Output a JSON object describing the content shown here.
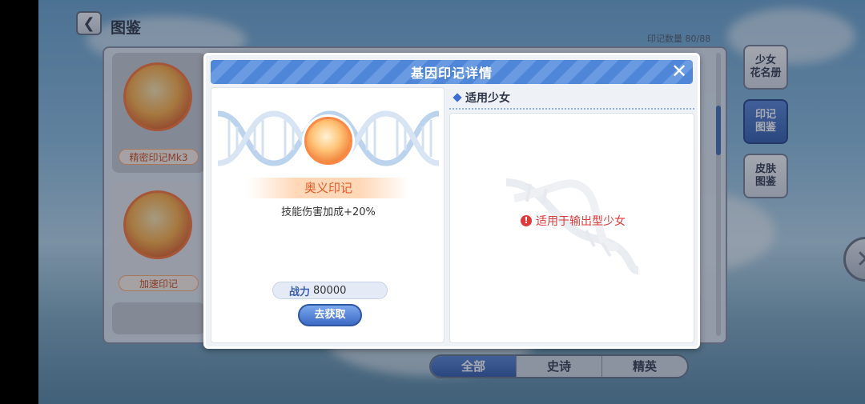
{
  "header": {
    "back_icon": "chevron-left-icon",
    "title": "图鉴",
    "count": "印记数量 80/88"
  },
  "background_list": {
    "items": [
      {
        "label": "精密印记Mk3"
      },
      {
        "label": "加速印记"
      }
    ]
  },
  "side_tabs": [
    {
      "label": "少女\n花名册",
      "active": false
    },
    {
      "label": "印记\n图鉴",
      "active": true
    },
    {
      "label": "皮肤\n图鉴",
      "active": false
    }
  ],
  "filter": {
    "tabs": [
      "全部",
      "史诗",
      "精英"
    ],
    "selected": "全部"
  },
  "dialog": {
    "title": "基因印记详情",
    "close_icon": "close-icon",
    "mark": {
      "name": "奥义印记",
      "effect": "技能伤害加成+20%",
      "power_label": "战力",
      "power_value": "80000",
      "get_button": "去获取"
    },
    "girls_section": {
      "title": "适用少女",
      "notice_icon": "!",
      "notice": "适用于输出型少女"
    }
  },
  "colors": {
    "accent_blue": "#4f86d8",
    "orange": "#e45a28",
    "notice_red": "#e03a3a"
  }
}
